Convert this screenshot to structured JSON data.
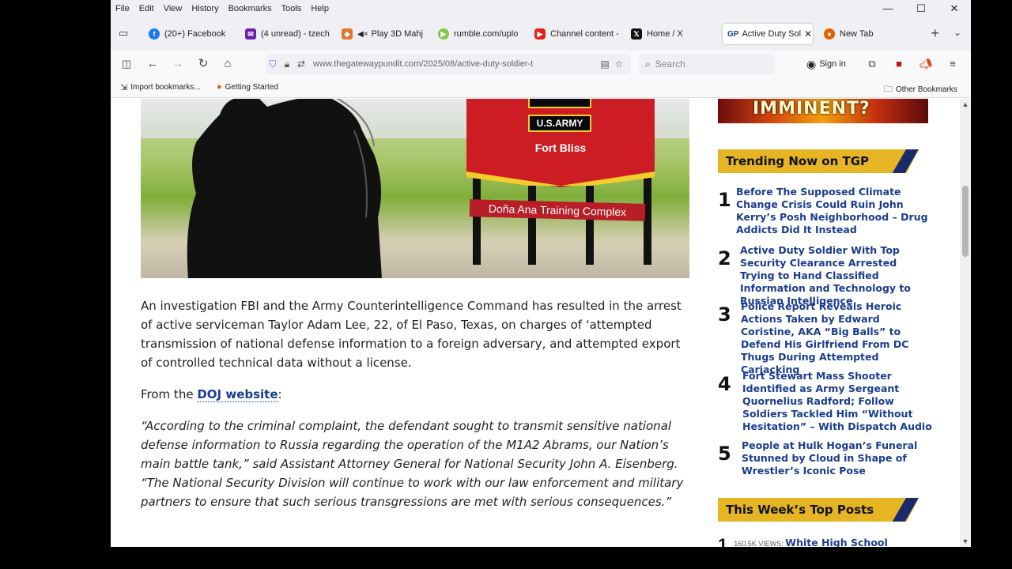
{
  "menu": [
    "File",
    "Edit",
    "View",
    "History",
    "Bookmarks",
    "Tools",
    "Help"
  ],
  "window_controls": {
    "minimize": "—",
    "maximize": "☐",
    "close": "✕"
  },
  "tabs": [
    {
      "label": "(20+) Facebook",
      "icon": "facebook-icon",
      "color": "#1877f2"
    },
    {
      "label": "(4 unread) - tzech",
      "icon": "mail-icon",
      "color": "#6b1fb1"
    },
    {
      "label": "Play 3D Mahj",
      "icon": "puzzle-icon",
      "color": "#e8732d",
      "muted": "◀×"
    },
    {
      "label": "rumble.com/uplo",
      "icon": "rumble-icon",
      "color": "#85c742"
    },
    {
      "label": "Channel content -",
      "icon": "youtube-icon",
      "color": "#e62117"
    },
    {
      "label": "Home / X",
      "icon": "x-icon",
      "color": "#111111"
    },
    {
      "label": "Active Duty Sol",
      "icon": "gp-icon",
      "color": "#1a3d8f",
      "prefix": "GP",
      "active": true,
      "close": "✕"
    },
    {
      "label": "New Tab",
      "icon": "firefox-icon",
      "color": "#e66000"
    }
  ],
  "new_tab": "+",
  "tab_overflow": "⌄",
  "url": "www.thegatewaypundit.com/2025/08/active-duty-soldier-t",
  "search_placeholder": "Search",
  "sign_in": "Sign in",
  "bookmarks": {
    "import": "Import bookmarks...",
    "getting_started": "Getting Started",
    "other": "Other Bookmarks"
  },
  "hero": {
    "usarmy": "U.S.ARMY",
    "fort_bliss": "Fort Bliss",
    "training": "Doña Ana Training Complex"
  },
  "article": {
    "p1": "An investigation FBI and the Army Counterintelligence Command has resulted in the arrest of active serviceman Taylor Adam Lee, 22, of El Paso, Texas, on charges of ‘attempted transmission of national defense information to a foreign adversary, and attempted export of controlled technical data without a license.",
    "from_prefix": "From the ",
    "doj_link": "DOJ website",
    "from_suffix": ":",
    "quote": "“According to the criminal complaint, the defendant sought to transmit sensitive national defense information to Russia regarding the operation of the M1A2 Abrams, our Nation’s main battle tank,” said Assistant Attorney General for National Security John A. Eisenberg. “The National Security Division will continue to work with our law enforcement and military partners to ensure that such serious transgressions are met with serious consequences.”"
  },
  "sidebar": {
    "promo": "IMMINENT?",
    "trending_title": "Trending Now on TGP",
    "trending": [
      {
        "num": "1",
        "title": "Before The Supposed Climate Change Crisis Could Ruin John Kerry’s Posh Neighborhood – Drug Addicts Did It Instead"
      },
      {
        "num": "2",
        "title": "Active Duty Soldier With Top Security Clearance Arrested Trying to Hand Classified Information and Technology to Russian Intelligence"
      },
      {
        "num": "3",
        "title": "Police Report Reveals Heroic Actions Taken by Edward Coristine, AKA “Big Balls” to Defend His Girlfriend From DC Thugs During Attempted Carjacking"
      },
      {
        "num": "4",
        "title": "Fort Stewart Mass Shooter Identified as Army Sergeant Quornelius Radford; Follow Soldiers Tackled Him “Without Hesitation” – With Dispatch Audio"
      },
      {
        "num": "5",
        "title": "People at Hulk Hogan’s Funeral Stunned by Cloud in Shape of Wrestler’s Iconic Pose"
      }
    ],
    "top_posts_title": "This Week’s Top Posts",
    "top_post_first": {
      "views": "160.5K VIEWS: ",
      "title": "White High School"
    }
  }
}
